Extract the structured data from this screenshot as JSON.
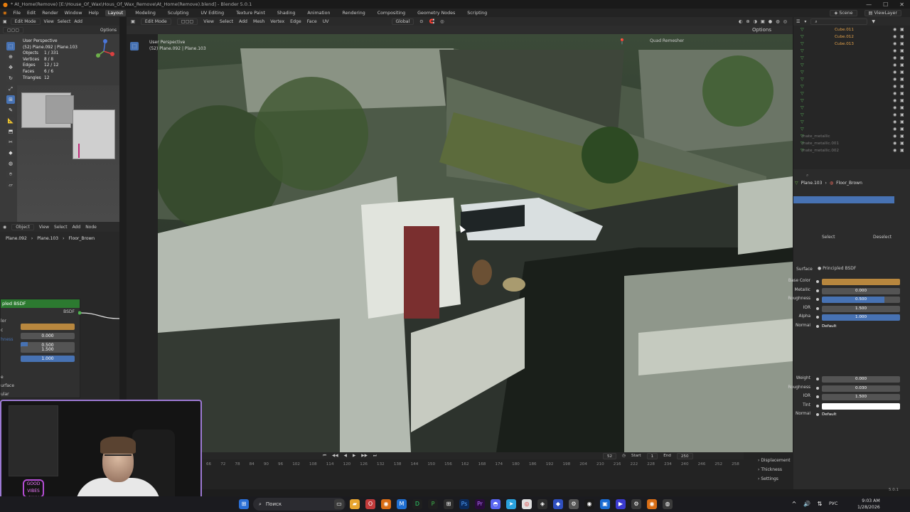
{
  "titlebar": {
    "title": "* At_Home(Remove) [E:\\House_Of_Wax\\Hous_Of_Wax_Remove\\At_Home(Remove).blend] - Blender 5.0.1"
  },
  "menubar": {
    "items": [
      "File",
      "Edit",
      "Render",
      "Window",
      "Help"
    ],
    "workspaces": [
      "Layout",
      "Modeling",
      "Sculpting",
      "UV Editing",
      "Texture Paint",
      "Shading",
      "Animation",
      "Rendering",
      "Compositing",
      "Geometry Nodes",
      "Scripting"
    ],
    "active_workspace": "Layout",
    "scene": "Scene",
    "view_layer": "ViewLayer"
  },
  "left_viewport": {
    "mode": "Edit Mode",
    "menus": [
      "View",
      "Select",
      "Add"
    ],
    "options": "Options",
    "title": "User Perspective",
    "subtitle": "(52) Plane.092 | Plane.103",
    "stats": [
      {
        "label": "Objects",
        "value": "1 / 331"
      },
      {
        "label": "Vertices",
        "value": "8 / 8"
      },
      {
        "label": "Edges",
        "value": "12 / 12"
      },
      {
        "label": "Faces",
        "value": "6 / 6"
      },
      {
        "label": "Triangles",
        "value": "12"
      }
    ]
  },
  "node_editor": {
    "mode": "Object",
    "menus": [
      "View",
      "Select",
      "Add",
      "Node"
    ],
    "breadcrumb": [
      "Plane.092",
      "Plane.103",
      "Floor_Brown"
    ],
    "node_title": "pled BSDF",
    "output_socket": "BSDF",
    "rows": [
      {
        "label": "lor",
        "value": ""
      },
      {
        "label": "c",
        "value": "0.000"
      },
      {
        "label": "hness",
        "value": "0.500"
      },
      {
        "label": "",
        "value": "1.500"
      },
      {
        "label": "",
        "value": "1.000"
      }
    ],
    "sections": [
      "e",
      "urface",
      "ular",
      "r"
    ],
    "colors": {
      "base": "#b8873e",
      "header": "#2c7a30"
    }
  },
  "main_viewport": {
    "mode": "Edit Mode",
    "menus": [
      "View",
      "Select",
      "Add",
      "Mesh",
      "Vertex",
      "Edge",
      "Face",
      "UV"
    ],
    "orientation": "Global",
    "options": "Options",
    "title": "User Perspective",
    "subtitle": "(52) Plane.092 | Plane.103",
    "addon_label": "Quad Remesher"
  },
  "timeline": {
    "start_label": "Start",
    "start": "1",
    "end_label": "End",
    "end": "250",
    "current": "52",
    "frames": [
      "66",
      "72",
      "78",
      "84",
      "90",
      "96",
      "102",
      "108",
      "114",
      "120",
      "126",
      "132",
      "138",
      "144",
      "150",
      "156",
      "162",
      "168",
      "174",
      "180",
      "186",
      "192",
      "198",
      "204",
      "210",
      "216",
      "222",
      "228",
      "234",
      "240",
      "246",
      "252",
      "258"
    ]
  },
  "timeline_side": [
    "Displacement",
    "Thickness",
    "Settings"
  ],
  "outliner": {
    "search_placeholder": "",
    "rows": [
      "Cube.011",
      "Cube.012",
      "Cube.013"
    ],
    "materials": [
      "mate_metallic",
      "mate_metallic.001",
      "mate_metallic.002"
    ]
  },
  "properties": {
    "breadcrumb": [
      "Plane.103",
      "Floor_Brown"
    ],
    "buttons": [
      "Select",
      "Deselect"
    ],
    "surface_label": "Surface",
    "surface_value": "Principled BSDF",
    "fields": [
      {
        "label": "Base Color",
        "value": "",
        "kind": "color"
      },
      {
        "label": "Metallic",
        "value": "0.000",
        "kind": "plain"
      },
      {
        "label": "Roughness",
        "value": "0.500",
        "kind": "half"
      },
      {
        "label": "IOR",
        "value": "1.500",
        "kind": "plain"
      },
      {
        "label": "Alpha",
        "value": "1.000",
        "kind": "blue"
      },
      {
        "label": "Normal",
        "value": "Default",
        "kind": "text"
      }
    ],
    "fields2": [
      {
        "label": "Weight",
        "value": "0.000",
        "kind": "plain"
      },
      {
        "label": "Roughness",
        "value": "0.030",
        "kind": "plain"
      },
      {
        "label": "IOR",
        "value": "1.500",
        "kind": "plain"
      },
      {
        "label": "Tint",
        "value": "",
        "kind": "white"
      },
      {
        "label": "Normal",
        "value": "Default",
        "kind": "text"
      }
    ],
    "version": "5.0.1"
  },
  "taskbar": {
    "search": "Поиск",
    "lang": "РУС",
    "time": "9:03 AM",
    "date": "1/28/2026"
  },
  "webcam": {
    "neon": "GOOD VIBES ONLY"
  }
}
